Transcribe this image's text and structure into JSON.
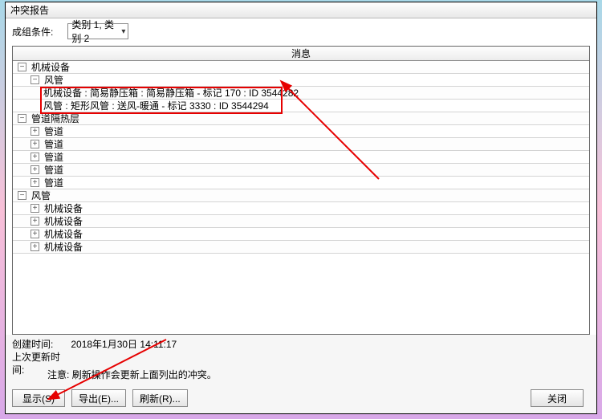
{
  "window": {
    "title": "冲突报告"
  },
  "filter": {
    "label": "成组条件:",
    "dropdown_value": "类别 1, 类别 2"
  },
  "table": {
    "column_header": "消息"
  },
  "tree": {
    "g0": {
      "label": "机械设备"
    },
    "g0c0": {
      "label": "风管"
    },
    "g0c0l0": {
      "label": "机械设备 : 简易静压箱 : 简易静压箱 - 标记 170 : ID 3544282"
    },
    "g0c0l1": {
      "label": "风管 : 矩形风管 : 送风-暖通 - 标记 3330 : ID 3544294"
    },
    "g1": {
      "label": "管道隔热层"
    },
    "g1c0": {
      "label": "管道"
    },
    "g1c1": {
      "label": "管道"
    },
    "g1c2": {
      "label": "管道"
    },
    "g1c3": {
      "label": "管道"
    },
    "g1c4": {
      "label": "管道"
    },
    "g2": {
      "label": "风管"
    },
    "g2c0": {
      "label": "机械设备"
    },
    "g2c1": {
      "label": "机械设备"
    },
    "g2c2": {
      "label": "机械设备"
    },
    "g2c3": {
      "label": "机械设备"
    }
  },
  "footer": {
    "created_label": "创建时间:",
    "created_value": "2018年1月30日  14:11:17",
    "updated_label": "上次更新时间:",
    "updated_value": "",
    "note_label": "注意:",
    "note_text": "刷新操作会更新上面列出的冲突。"
  },
  "buttons": {
    "show": "显示(S)",
    "export": "导出(E)...",
    "refresh": "刷新(R)...",
    "close": "关闭"
  },
  "glyphs": {
    "plus": "+",
    "minus": "−",
    "chevron": "▾"
  }
}
